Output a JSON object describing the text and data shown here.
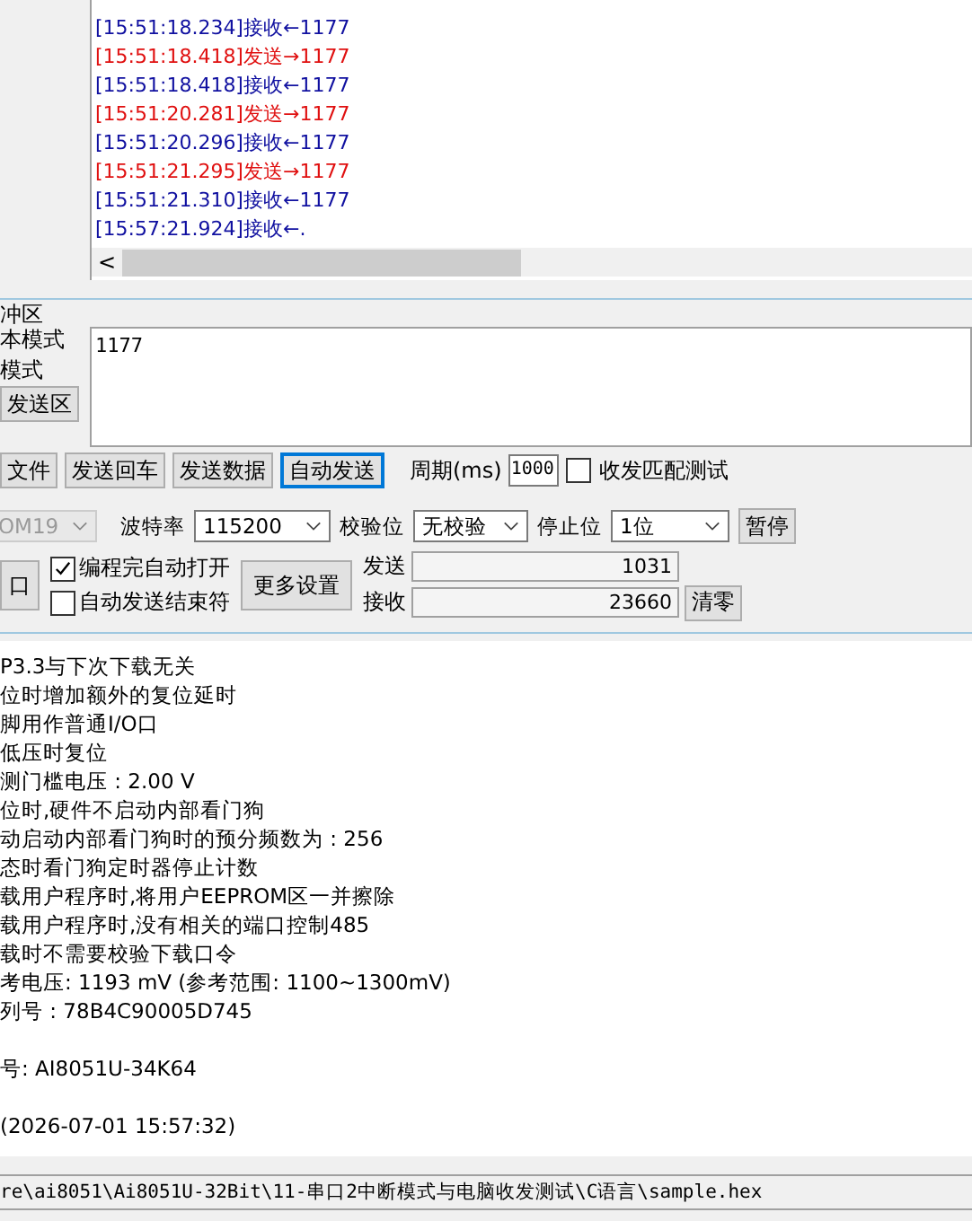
{
  "receive_log": [
    {
      "kind": "recv",
      "text": "[15:51:18.234]接收←1177"
    },
    {
      "kind": "send",
      "text": "[15:51:18.418]发送→1177"
    },
    {
      "kind": "recv",
      "text": "[15:51:18.418]接收←1177"
    },
    {
      "kind": "send",
      "text": "[15:51:20.281]发送→1177"
    },
    {
      "kind": "recv",
      "text": "[15:51:20.296]接收←1177"
    },
    {
      "kind": "send",
      "text": "[15:51:21.295]发送→1177"
    },
    {
      "kind": "recv",
      "text": "[15:51:21.310]接收←1177"
    },
    {
      "kind": "recv",
      "text": "[15:57:21.924]接收←."
    }
  ],
  "scroll_arrow": "<",
  "send_buffer": {
    "title": "冲区",
    "options": [
      "本模式",
      "模式"
    ],
    "clear_button": "发送区",
    "value": "1177"
  },
  "send_buttons": [
    {
      "label": "文件",
      "selected": false
    },
    {
      "label": "发送回车",
      "selected": false
    },
    {
      "label": "发送数据",
      "selected": false
    },
    {
      "label": "自动发送",
      "selected": true
    }
  ],
  "period": {
    "label": "周期(ms)",
    "value": "1000"
  },
  "match_test": {
    "label": "收发匹配测试",
    "checked": false
  },
  "port": {
    "value": "OM19",
    "disabled": true
  },
  "serial_settings": [
    {
      "label": "波特率",
      "value": "115200"
    },
    {
      "label": "校验位",
      "value": "无校验"
    },
    {
      "label": "停止位",
      "value": "1位"
    }
  ],
  "pause_button": "暂停",
  "open_button": "口",
  "options": [
    {
      "label": "编程完自动打开",
      "checked": true
    },
    {
      "label": "自动发送结束符",
      "checked": false
    }
  ],
  "more_settings_button": "更多设置",
  "counters": [
    {
      "label": "发送",
      "value": "1031"
    },
    {
      "label": "接收",
      "value": "23660"
    }
  ],
  "clear_button": "清零",
  "info_log": [
    {
      "lines": [
        "P3.3与下次下载无关",
        "位时增加额外的复位延时",
        "脚用作普通I/O口",
        "低压时复位",
        "测门槛电压 : 2.00 V",
        "位时,硬件不启动内部看门狗",
        "动启动内部看门狗时的预分频数为 : 256",
        "态时看门狗定时器停止计数",
        "载用户程序时,将用户EEPROM区一并擦除",
        "载用户程序时,没有相关的端口控制485",
        "载时不需要校验下载口令",
        "考电压: 1193 mV (参考范围: 1100~1300mV)",
        "列号 : 78B4C90005D745"
      ]
    },
    {
      "lines": [
        "号: AI8051U-34K64"
      ]
    },
    {
      "lines": [
        "(2026-07-01 15:57:32)"
      ]
    }
  ],
  "status_bar": "re\\ai8051\\Ai8051U-32Bit\\11-串口2中断模式与电脑收发测试\\C语言\\sample.hex"
}
